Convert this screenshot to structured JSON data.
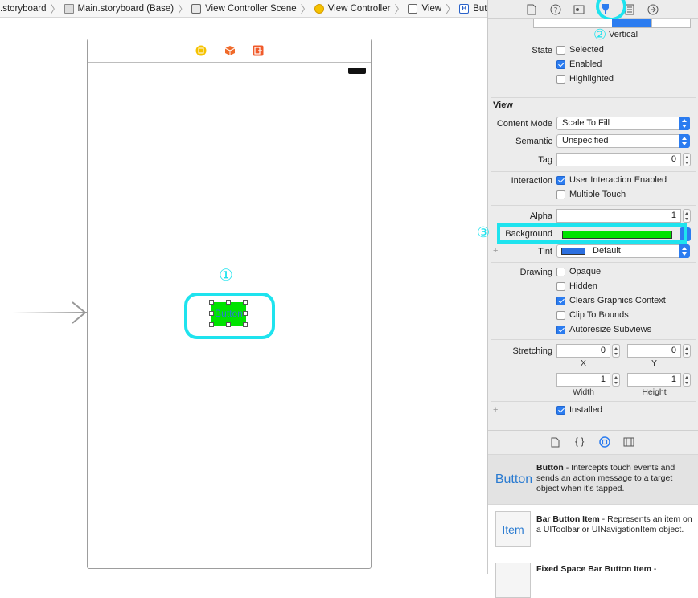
{
  "breadcrumb": {
    "items": [
      {
        "label": ".storyboard",
        "icon": "none"
      },
      {
        "label": "Main.storyboard (Base)",
        "icon": "storyboard-icon"
      },
      {
        "label": "View Controller Scene",
        "icon": "scene-icon"
      },
      {
        "label": "View Controller",
        "icon": "view-controller-icon"
      },
      {
        "label": "View",
        "icon": "view-icon"
      },
      {
        "label": "Button",
        "icon": "button-icon"
      }
    ],
    "button_badge": "B"
  },
  "canvas": {
    "button_label": "Button",
    "annotation_1": "①",
    "dock_icons": [
      "view-controller-icon",
      "first-responder-icon",
      "exit-icon"
    ]
  },
  "inspector": {
    "tabs": [
      "file-icon",
      "help-icon",
      "identity-icon",
      "attributes-icon",
      "size-icon",
      "connections-icon"
    ],
    "annotation_2": "②",
    "annotation_3": "③",
    "axis_label": "Vertical",
    "state": {
      "label": "State",
      "selected": {
        "label": "Selected",
        "checked": false
      },
      "enabled": {
        "label": "Enabled",
        "checked": true
      },
      "highlighted": {
        "label": "Highlighted",
        "checked": false
      }
    },
    "view_section": "View",
    "content_mode": {
      "label": "Content Mode",
      "value": "Scale To Fill"
    },
    "semantic": {
      "label": "Semantic",
      "value": "Unspecified"
    },
    "tag": {
      "label": "Tag",
      "value": "0"
    },
    "interaction": {
      "label": "Interaction",
      "user_interaction": {
        "label": "User Interaction Enabled",
        "checked": true
      },
      "multiple_touch": {
        "label": "Multiple Touch",
        "checked": false
      }
    },
    "alpha": {
      "label": "Alpha",
      "value": "1"
    },
    "background": {
      "label": "Background",
      "color": "#00e300"
    },
    "tint": {
      "label": "Tint",
      "value": "Default",
      "color": "#2b6fe0"
    },
    "drawing": {
      "label": "Drawing",
      "opaque": {
        "label": "Opaque",
        "checked": false
      },
      "hidden": {
        "label": "Hidden",
        "checked": false
      },
      "clears": {
        "label": "Clears Graphics Context",
        "checked": true
      },
      "clip": {
        "label": "Clip To Bounds",
        "checked": false
      },
      "autoresize": {
        "label": "Autoresize Subviews",
        "checked": true
      }
    },
    "stretching": {
      "label": "Stretching",
      "x": "0",
      "y": "0",
      "width": "1",
      "height": "1",
      "x_label": "X",
      "y_label": "Y",
      "width_label": "Width",
      "height_label": "Height"
    },
    "installed": {
      "label": "Installed",
      "checked": true
    }
  },
  "library": {
    "tabs": [
      "file-template-icon",
      "code-snippet-icon",
      "object-library-icon",
      "media-library-icon"
    ],
    "items": [
      {
        "thumb": "Button",
        "title": "Button",
        "desc": " - Intercepts touch events and sends an action message to a target object when it's tapped."
      },
      {
        "thumb": "Item",
        "title": "Bar Button Item",
        "desc": " - Represents an item on a UIToolbar or UINavigationItem object."
      },
      {
        "thumb": "",
        "title": "Fixed Space Bar Button Item",
        "desc": " -"
      }
    ]
  }
}
